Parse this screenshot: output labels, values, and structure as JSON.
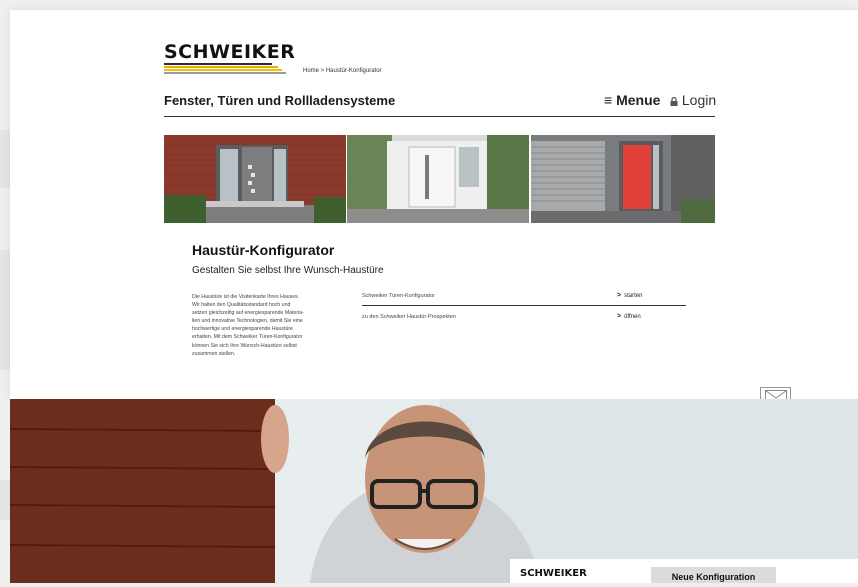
{
  "brand": {
    "name": "SCHWEIKER",
    "stripe_colors": [
      "#2b2b2b",
      "#f2a900",
      "#f2c200",
      "#9a9a9a"
    ]
  },
  "breadcrumb": {
    "text": "Home > Haustür-Konfigurator"
  },
  "header": {
    "subtitle": "Fenster, Türen und Rollladensysteme",
    "menu_label": "Menue",
    "login_label": "Login"
  },
  "intro": {
    "title": "Haustür-Konfigurator",
    "subtitle": "Gestalten Sie selbst Ihre Wunsch-Haustüre",
    "paragraph_lines": [
      "Die Haustüre ist die Visitenkarte Ihres Hauses.",
      "Wir halten den Qualitätsstandard hoch und",
      "setzen gleichzeitig auf energiesparende Materia-",
      "lien und innovative Technologien, damit Sie eine",
      "hochwertige und energiesparende Haustüre",
      "erhalten. Mit dem Schweiker Türen-Konfigurator",
      "können Sie sich Ihre Wunsch-Haustüre selbst",
      "zusammen stellen."
    ]
  },
  "links": [
    {
      "label": "Schweiker Türen-Konfigurator",
      "action": "starten"
    },
    {
      "label": "zu den Schweiker Haustür-Prospekten",
      "action": "öffnen"
    }
  ],
  "footer_bar": {
    "logo": "SCHWEIKER",
    "button": "Neue Konfiguration"
  }
}
